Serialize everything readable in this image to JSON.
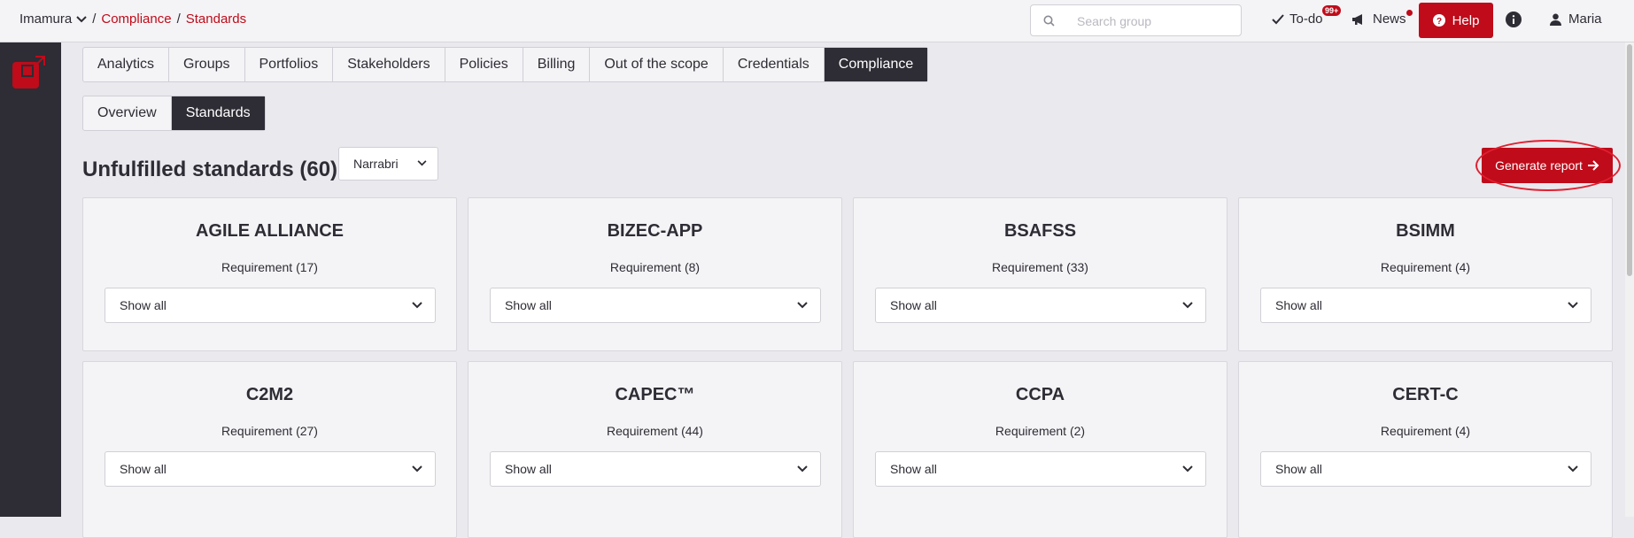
{
  "topbar": {
    "org": "Imamura",
    "crumb_sep": "/",
    "crumbs": [
      "Compliance",
      "Standards"
    ],
    "search_placeholder": "Search group",
    "todo_label": "To-do",
    "todo_badge": "99+",
    "news_label": "News",
    "help_label": "Help",
    "user_name": "Maria"
  },
  "tabs": [
    "Analytics",
    "Groups",
    "Portfolios",
    "Stakeholders",
    "Policies",
    "Billing",
    "Out of the scope",
    "Credentials",
    "Compliance"
  ],
  "active_tab": "Compliance",
  "subtabs": [
    "Overview",
    "Standards"
  ],
  "active_subtab": "Standards",
  "heading": "Unfulfilled standards (60)",
  "filter_select": "Narrabri",
  "generate_report_label": "Generate report",
  "cards": [
    {
      "title": "AGILE ALLIANCE",
      "requirement": "Requirement (17)",
      "select": "Show all"
    },
    {
      "title": "BIZEC-APP",
      "requirement": "Requirement (8)",
      "select": "Show all"
    },
    {
      "title": "BSAFSS",
      "requirement": "Requirement (33)",
      "select": "Show all"
    },
    {
      "title": "BSIMM",
      "requirement": "Requirement (4)",
      "select": "Show all"
    },
    {
      "title": "C2M2",
      "requirement": "Requirement (27)",
      "select": "Show all"
    },
    {
      "title": "CAPEC™",
      "requirement": "Requirement (44)",
      "select": "Show all"
    },
    {
      "title": "CCPA",
      "requirement": "Requirement (2)",
      "select": "Show all"
    },
    {
      "title": "CERT-C",
      "requirement": "Requirement (4)",
      "select": "Show all"
    }
  ],
  "colors": {
    "accent": "#bf0b1a",
    "dark": "#2e2c34",
    "background": "#e9e9ee",
    "card": "#f4f4f6"
  }
}
